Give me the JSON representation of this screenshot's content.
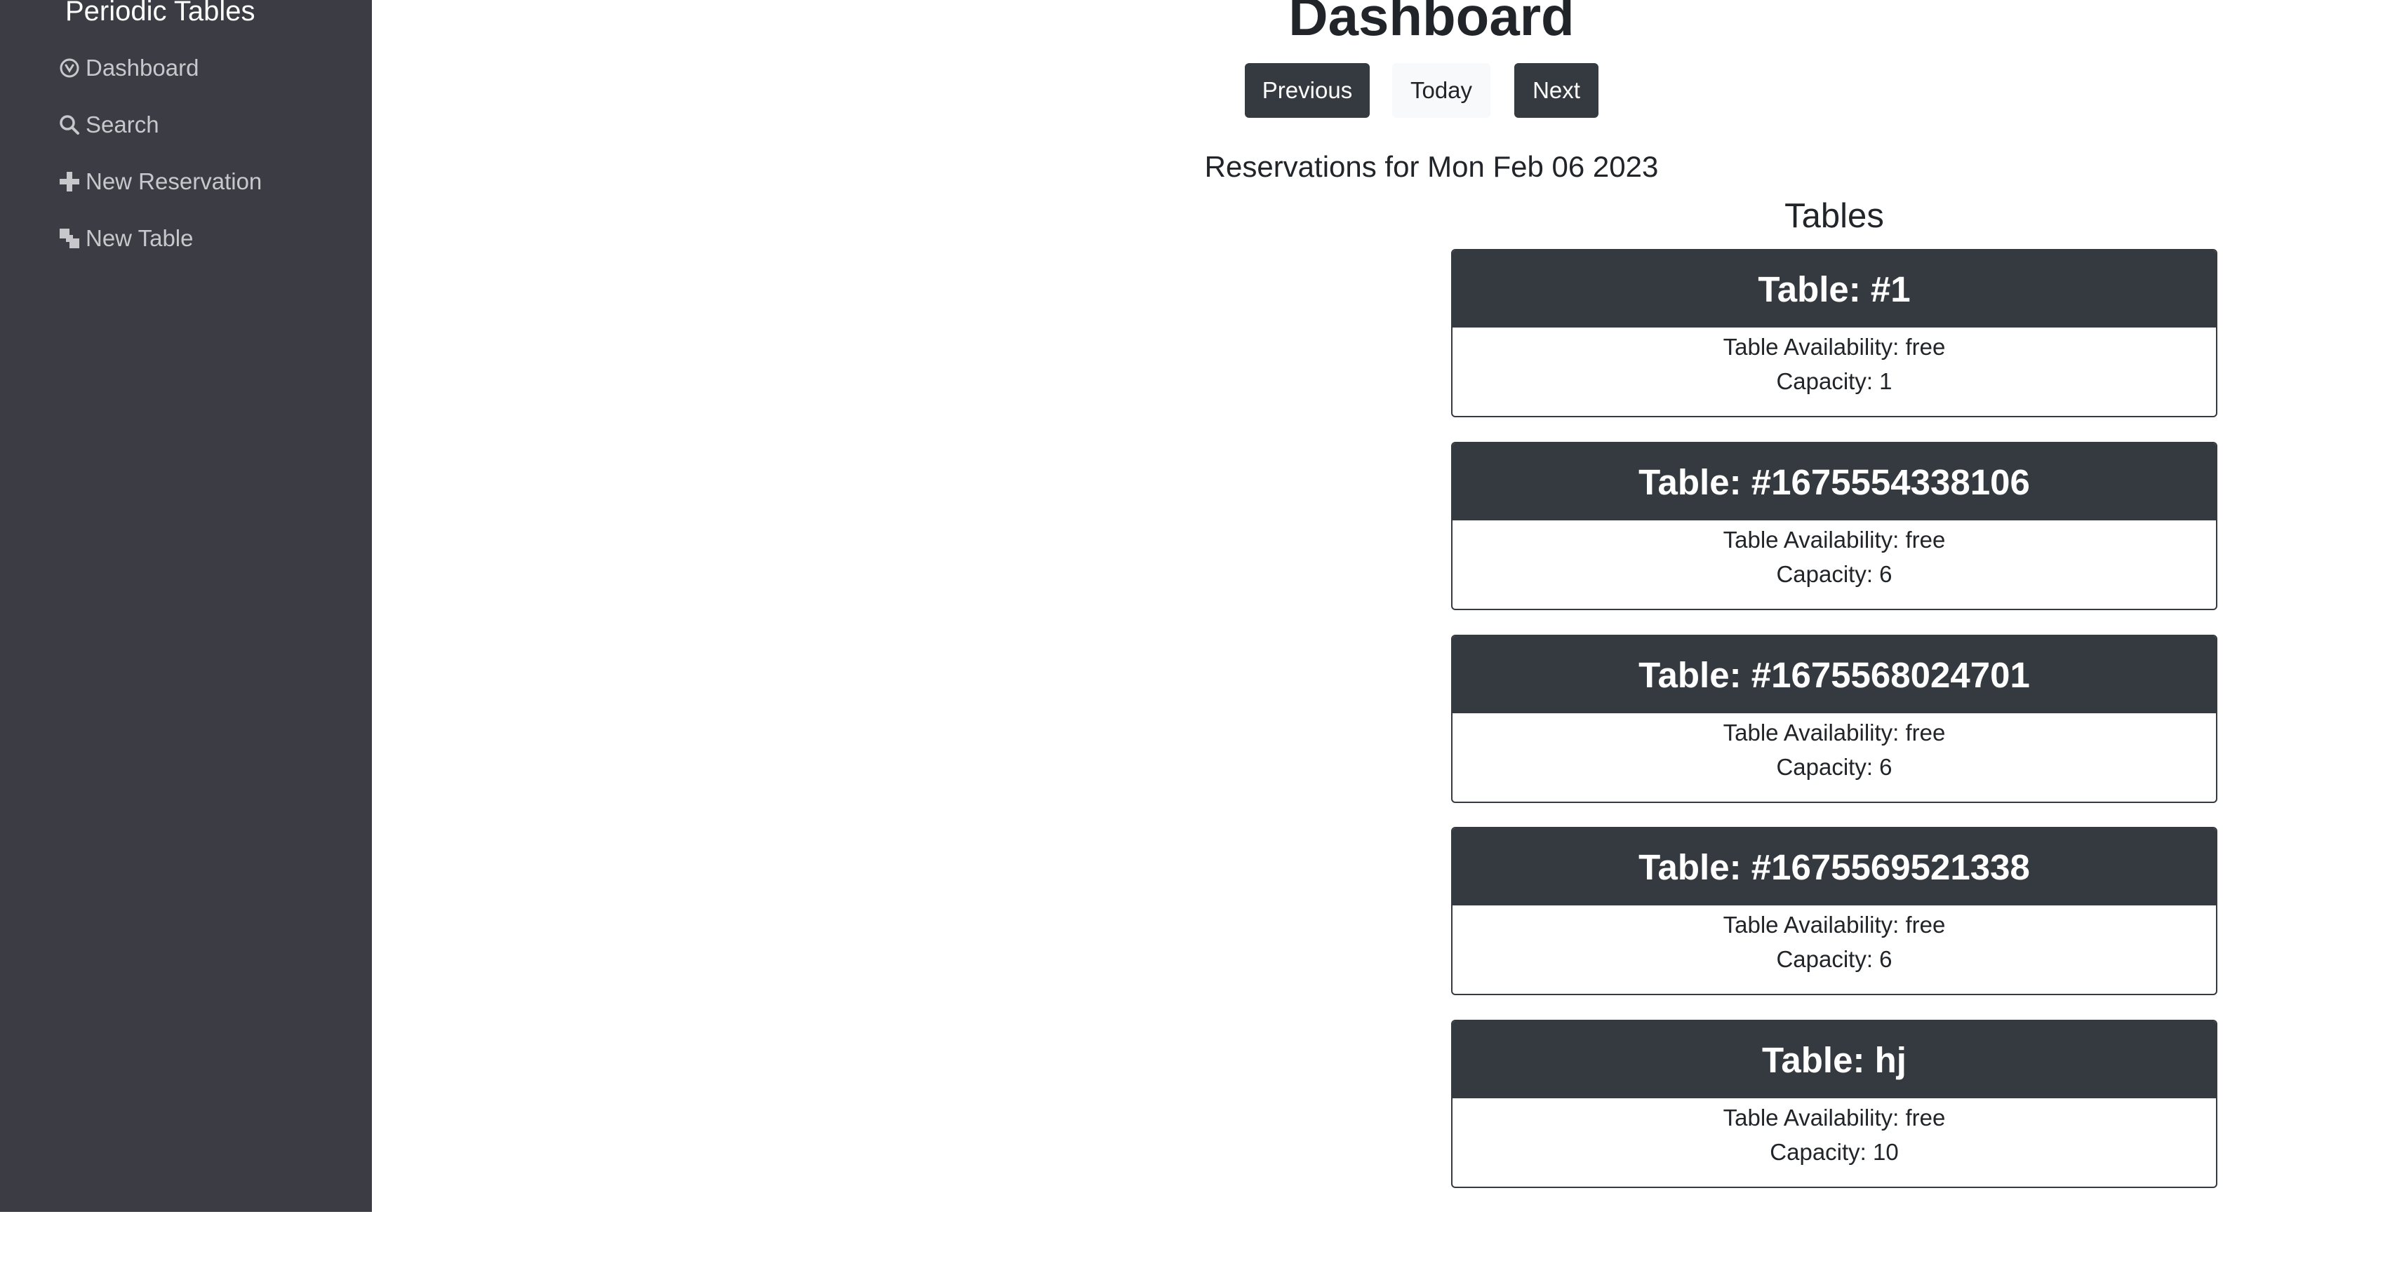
{
  "sidebar": {
    "brand": "Periodic Tables",
    "items": [
      {
        "label": "Dashboard",
        "icon": "dashboard-icon"
      },
      {
        "label": "Search",
        "icon": "search-icon"
      },
      {
        "label": "New Reservation",
        "icon": "plus-icon"
      },
      {
        "label": "New Table",
        "icon": "layers-icon"
      }
    ]
  },
  "main": {
    "title": "Dashboard",
    "buttons": {
      "previous": "Previous",
      "today": "Today",
      "next": "Next"
    },
    "reservations_heading": "Reservations for Mon Feb 06 2023",
    "tables_heading": "Tables",
    "tables": [
      {
        "title": "Table: #1",
        "availability": "Table Availability: free",
        "capacity": "Capacity: 1"
      },
      {
        "title": "Table: #1675554338106",
        "availability": "Table Availability: free",
        "capacity": "Capacity: 6"
      },
      {
        "title": "Table: #1675568024701",
        "availability": "Table Availability: free",
        "capacity": "Capacity: 6"
      },
      {
        "title": "Table: #1675569521338",
        "availability": "Table Availability: free",
        "capacity": "Capacity: 6"
      },
      {
        "title": "Table: hj",
        "availability": "Table Availability: free",
        "capacity": "Capacity: 10"
      }
    ]
  },
  "colors": {
    "sidebar_bg": "#3b3c44",
    "dark": "#343a40",
    "light_button": "#f8f9fa"
  }
}
